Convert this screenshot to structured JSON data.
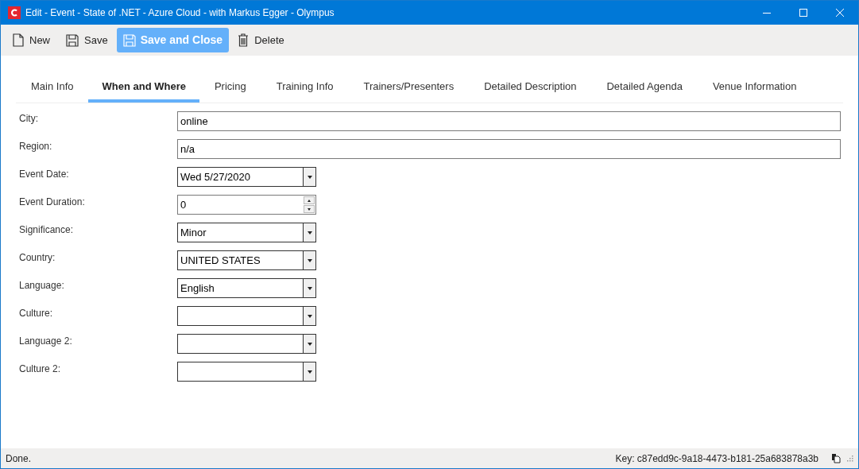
{
  "window": {
    "title": "Edit - Event - State of .NET - Azure Cloud - with Markus Egger - Olympus"
  },
  "toolbar": [
    {
      "label": "New",
      "kind": "new",
      "primary": false
    },
    {
      "label": "Save",
      "kind": "save",
      "primary": false
    },
    {
      "label": "Save and Close",
      "kind": "save",
      "primary": true
    },
    {
      "label": "Delete",
      "kind": "delete",
      "primary": false
    }
  ],
  "tabs": [
    {
      "label": "Main Info",
      "selected": false
    },
    {
      "label": "When and Where",
      "selected": true
    },
    {
      "label": "Pricing",
      "selected": false
    },
    {
      "label": "Training Info",
      "selected": false
    },
    {
      "label": "Trainers/Presenters",
      "selected": false
    },
    {
      "label": "Detailed Description",
      "selected": false
    },
    {
      "label": "Detailed Agenda",
      "selected": false
    },
    {
      "label": "Venue Information",
      "selected": false
    }
  ],
  "fields": [
    {
      "label": "City:",
      "kind": "text",
      "value": "online"
    },
    {
      "label": "Region:",
      "kind": "text",
      "value": "n/a"
    },
    {
      "label": "Event Date:",
      "kind": "dropdown",
      "value": "Wed 5/27/2020"
    },
    {
      "label": "Event Duration:",
      "kind": "spinner",
      "value": "0"
    },
    {
      "label": "Significance:",
      "kind": "dropdown",
      "value": "Minor"
    },
    {
      "label": "Country:",
      "kind": "dropdown",
      "value": "UNITED STATES"
    },
    {
      "label": "Language:",
      "kind": "dropdown",
      "value": "English"
    },
    {
      "label": "Culture:",
      "kind": "dropdown"
    },
    {
      "label": "Language 2:",
      "kind": "dropdown"
    },
    {
      "label": "Culture 2:",
      "kind": "dropdown"
    }
  ],
  "status_bar": {
    "message": "Done.",
    "key": "Key: c87edd9c-9a18-4473-b181-25a683878a3b"
  }
}
